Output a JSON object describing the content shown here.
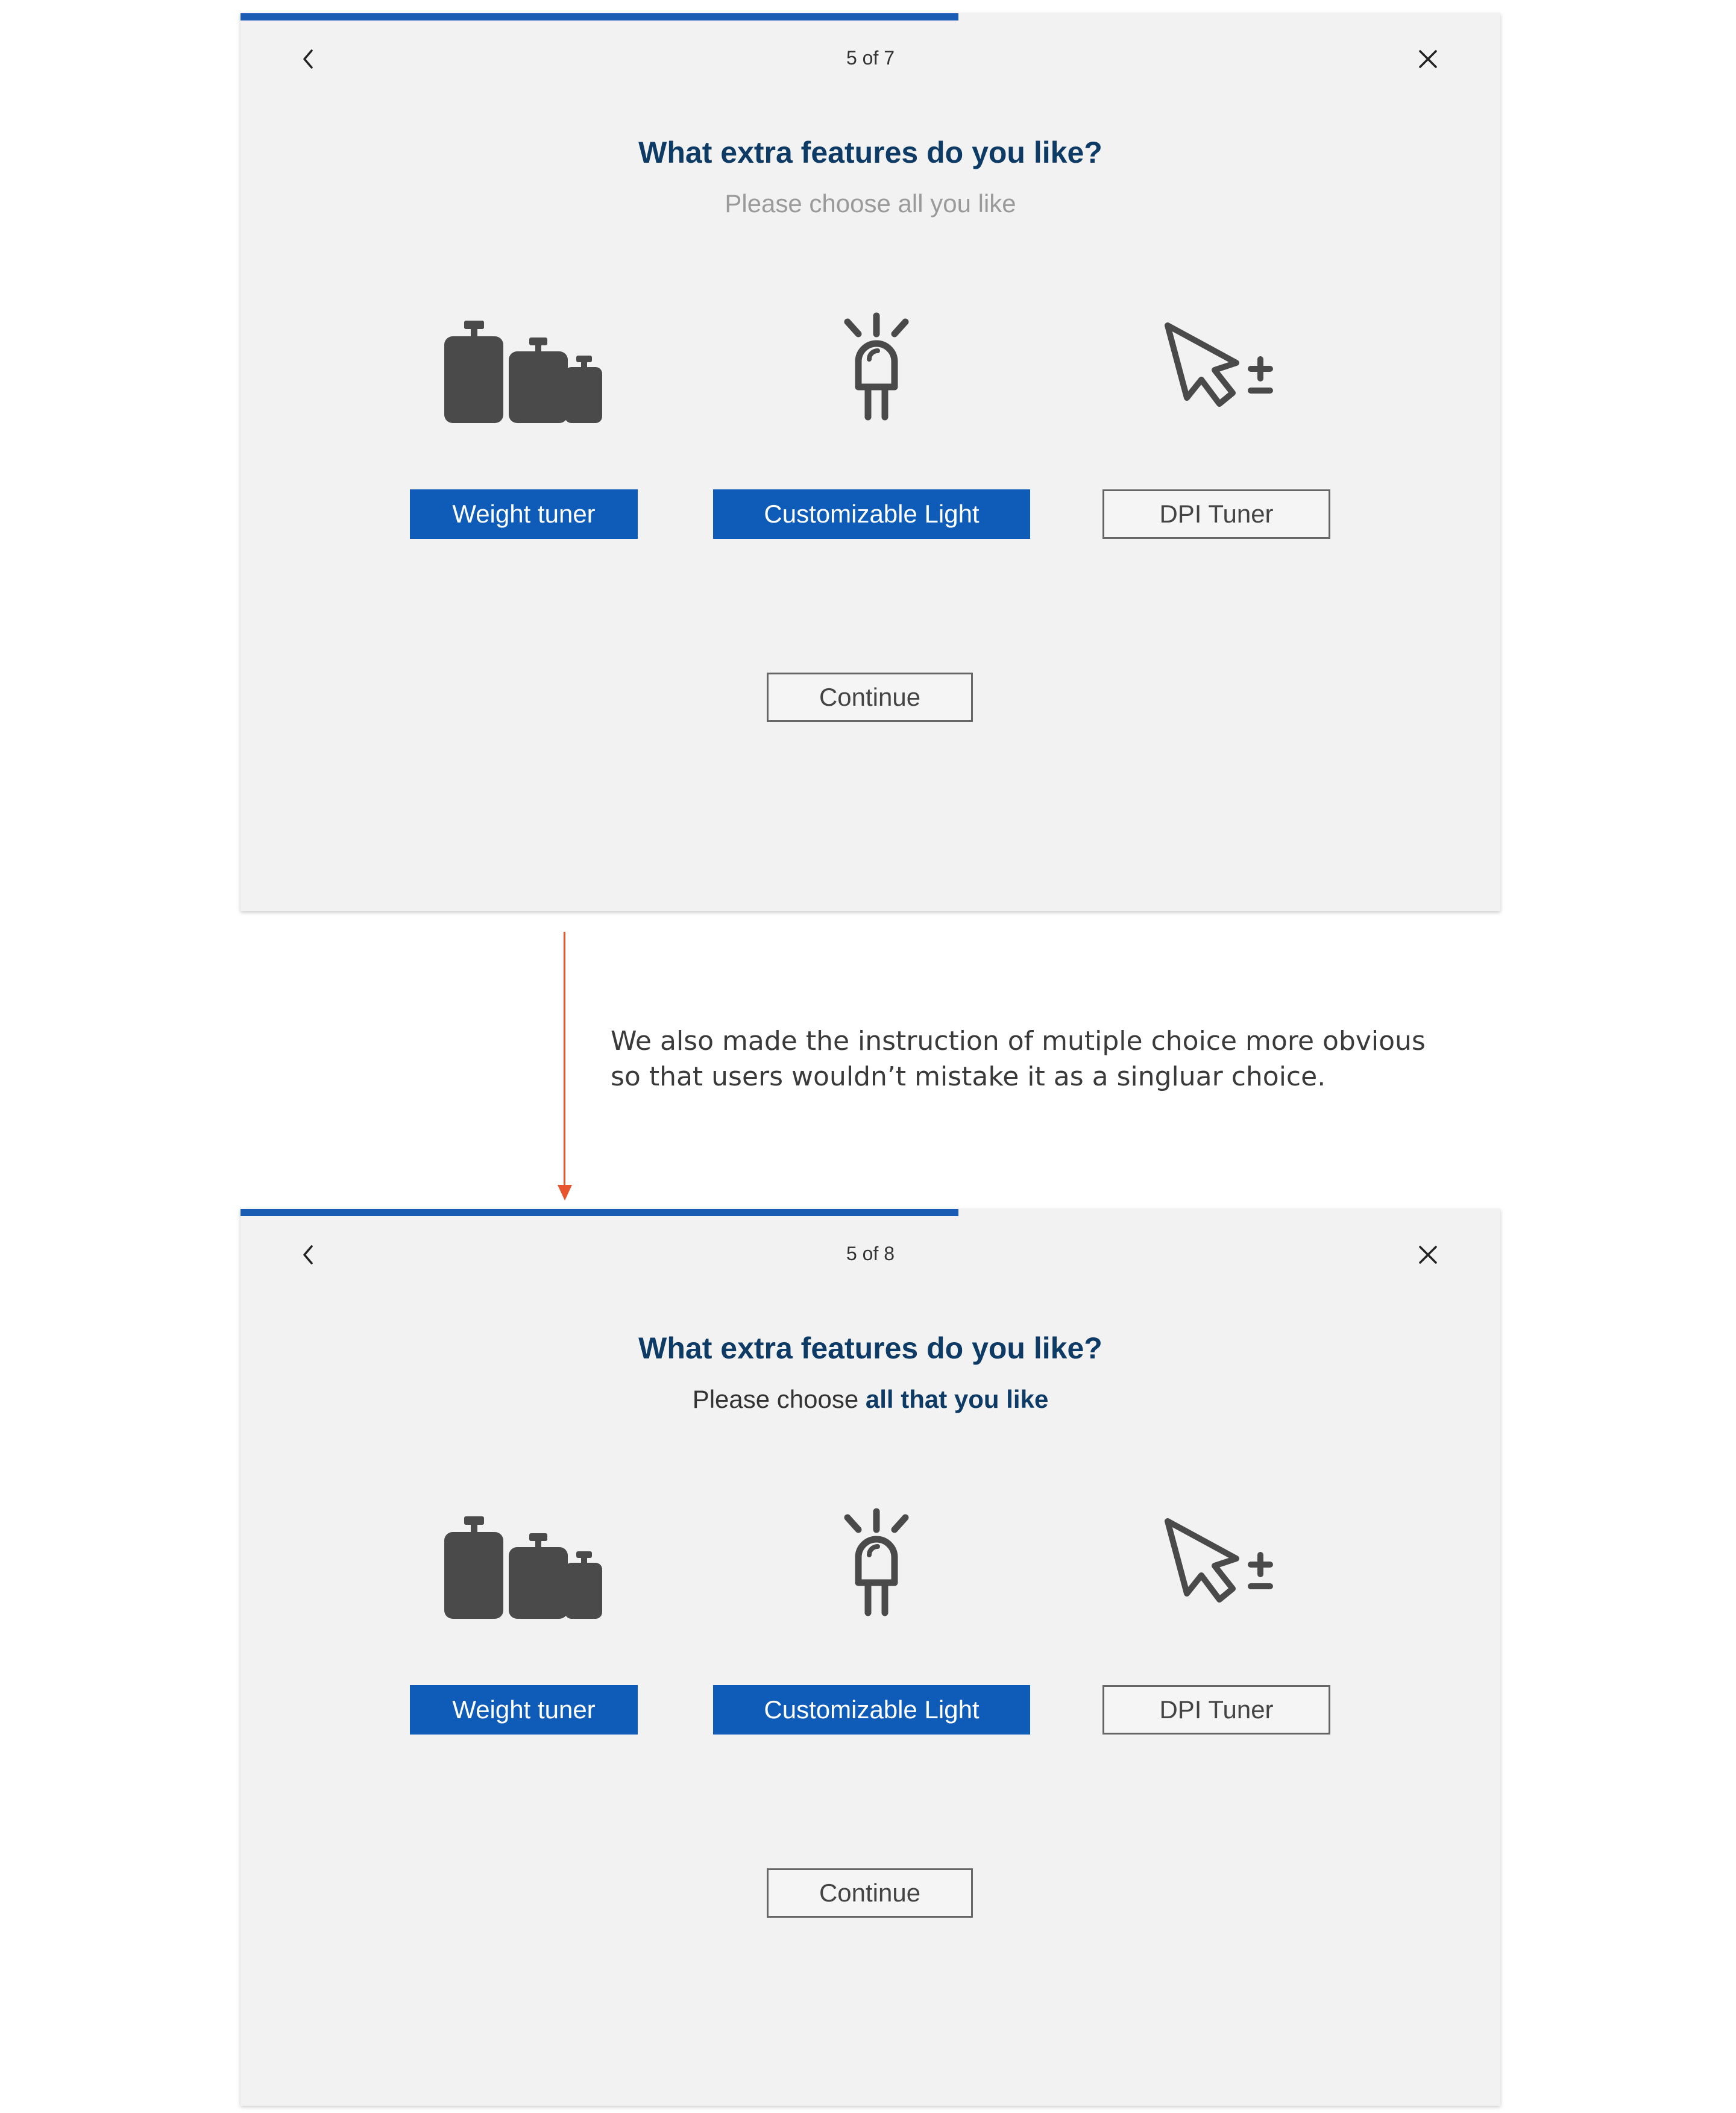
{
  "before": {
    "progress": 0.57,
    "step_text": "5 of 7",
    "question": "What extra features do you like?",
    "subtitle_plain": "Please choose all you like",
    "options": [
      {
        "label": "Weight tuner",
        "selected": true,
        "icon": "weights-icon"
      },
      {
        "label": "Customizable Light",
        "selected": true,
        "icon": "led-light-icon"
      },
      {
        "label": "DPI Tuner",
        "selected": false,
        "icon": "cursor-plus-minus-icon"
      }
    ],
    "continue_label": "Continue"
  },
  "annotation": {
    "line1": "We also made the instruction of mutiple choice more obvious",
    "line2": "so that users wouldn’t mistake it as a singluar choice."
  },
  "after": {
    "progress": 0.57,
    "step_text": "5 of 8",
    "question": "What extra features do you like?",
    "subtitle_prefix": "Please choose ",
    "subtitle_emphasis": "all that you like",
    "options": [
      {
        "label": "Weight tuner",
        "selected": true,
        "icon": "weights-icon"
      },
      {
        "label": "Customizable Light",
        "selected": true,
        "icon": "led-light-icon"
      },
      {
        "label": "DPI Tuner",
        "selected": false,
        "icon": "cursor-plus-minus-icon"
      }
    ],
    "continue_label": "Continue"
  },
  "colors": {
    "accent": "#1a5cb3",
    "heading": "#0e3a66",
    "icon": "#4a4a4a",
    "arrow": "#e8542e",
    "panel_bg": "#f2f2f2"
  }
}
